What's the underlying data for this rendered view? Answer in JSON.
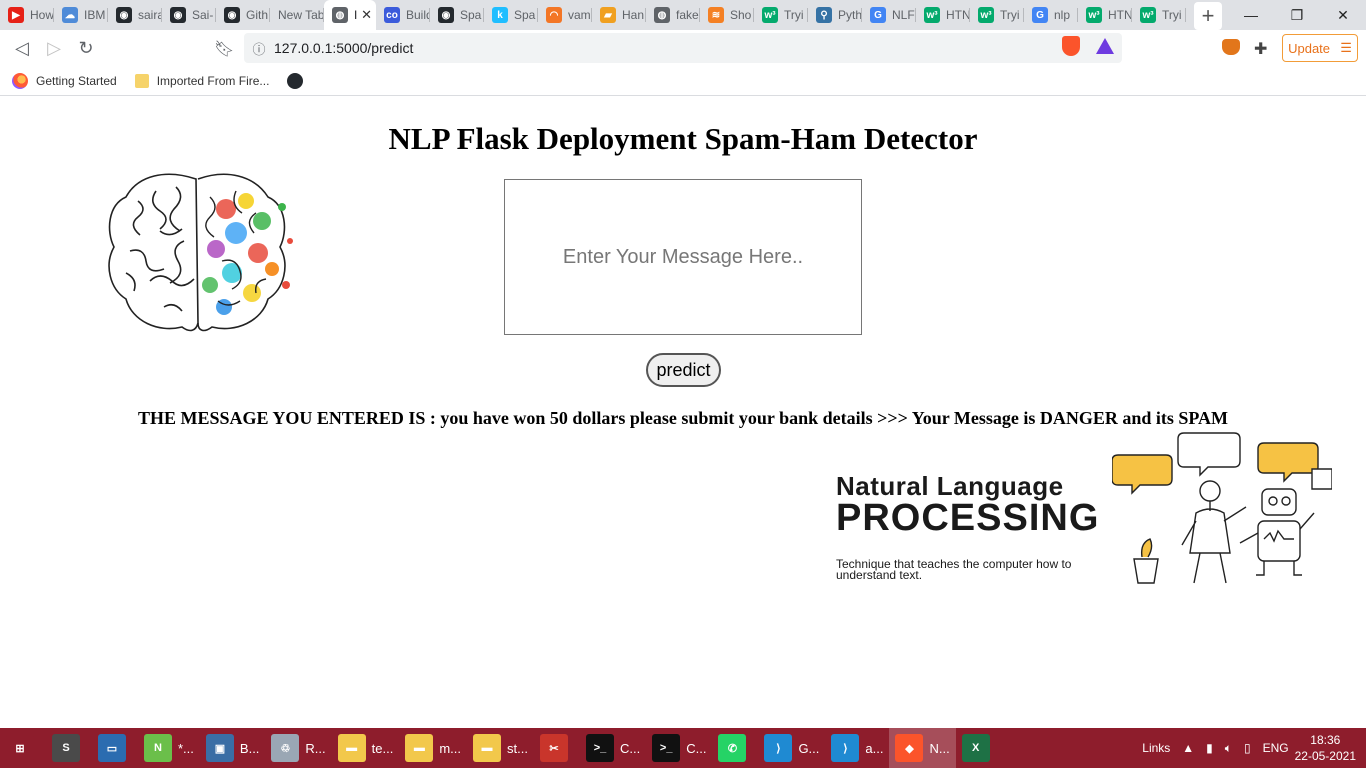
{
  "browser": {
    "tabs": [
      {
        "label": "How",
        "color": "#e62117",
        "glyph": "▶"
      },
      {
        "label": "IBM",
        "color": "#4f8bd8",
        "glyph": "☁"
      },
      {
        "label": "saira",
        "color": "#24292e",
        "glyph": "◉"
      },
      {
        "label": "Sai-",
        "color": "#24292e",
        "glyph": "◉"
      },
      {
        "label": "Gith",
        "color": "#24292e",
        "glyph": "◉"
      },
      {
        "label": "New Tab",
        "color": "",
        "glyph": ""
      },
      {
        "label": "I",
        "color": "#5f6368",
        "glyph": "◍",
        "active": true
      },
      {
        "label": "Build",
        "color": "#3b5bdb",
        "glyph": "co"
      },
      {
        "label": "Spa",
        "color": "#24292e",
        "glyph": "◉"
      },
      {
        "label": "Spa",
        "color": "#20beff",
        "glyph": "k"
      },
      {
        "label": "vam",
        "color": "#f37626",
        "glyph": "◠"
      },
      {
        "label": "Han",
        "color": "#f0a020",
        "glyph": "▰"
      },
      {
        "label": "fake",
        "color": "#5f6368",
        "glyph": "◍"
      },
      {
        "label": "Sho",
        "color": "#f48024",
        "glyph": "≋"
      },
      {
        "label": "Tryi",
        "color": "#04aa6d",
        "glyph": "w³"
      },
      {
        "label": "Pyth",
        "color": "#3572a5",
        "glyph": "⚲"
      },
      {
        "label": "NLF",
        "color": "#4285f4",
        "glyph": "G"
      },
      {
        "label": "HTN",
        "color": "#04aa6d",
        "glyph": "w³"
      },
      {
        "label": "Tryi",
        "color": "#04aa6d",
        "glyph": "w³"
      },
      {
        "label": "nlp",
        "color": "#4285f4",
        "glyph": "G"
      },
      {
        "label": "HTN",
        "color": "#04aa6d",
        "glyph": "w³"
      },
      {
        "label": "Tryi",
        "color": "#04aa6d",
        "glyph": "w³"
      }
    ],
    "url": "127.0.0.1:5000/predict",
    "update_label": "Update",
    "bookmarks": [
      {
        "label": "Getting Started",
        "type": "firefox"
      },
      {
        "label": "Imported From Fire...",
        "type": "folder"
      },
      {
        "label": "",
        "type": "github"
      }
    ]
  },
  "page": {
    "title": "NLP Flask Deployment Spam-Ham Detector",
    "message_placeholder": "Enter Your Message Here..",
    "predict_label": "predict",
    "result_text": "THE MESSAGE YOU ENTERED IS : you have won 50 dollars please submit your bank details >>> Your Message is DANGER and its SPAM",
    "banner": {
      "line1": "Natural Language",
      "line2": "PROCESSING",
      "line3": "Technique that teaches the computer how to understand text."
    }
  },
  "taskbar": {
    "items": [
      {
        "label": "",
        "icon": "windows-start-icon",
        "color": "#8e1d2c",
        "glyph": "⊞"
      },
      {
        "label": "",
        "icon": "sublime-icon",
        "color": "#4a4a4a",
        "glyph": "S"
      },
      {
        "label": "",
        "icon": "remote-desktop-icon",
        "color": "#2b6cb0",
        "glyph": "▭"
      },
      {
        "label": "*...",
        "icon": "notepad-plus-icon",
        "color": "#6bbf4a",
        "glyph": "N"
      },
      {
        "label": "B...",
        "icon": "computer-icon",
        "color": "#3a6ea5",
        "glyph": "▣"
      },
      {
        "label": "R...",
        "icon": "recycle-bin-icon",
        "color": "#9aa7b4",
        "glyph": "♲"
      },
      {
        "label": "te...",
        "icon": "folder-icon",
        "color": "#f2c84b",
        "glyph": "▬"
      },
      {
        "label": "m...",
        "icon": "folder-icon",
        "color": "#f2c84b",
        "glyph": "▬"
      },
      {
        "label": "st...",
        "icon": "folder-icon",
        "color": "#f2c84b",
        "glyph": "▬"
      },
      {
        "label": "",
        "icon": "snipping-tool-icon",
        "color": "#c9352b",
        "glyph": "✂"
      },
      {
        "label": "C...",
        "icon": "cmd-icon",
        "color": "#111111",
        "glyph": ">_"
      },
      {
        "label": "C...",
        "icon": "cmd-icon",
        "color": "#111111",
        "glyph": ">_"
      },
      {
        "label": "",
        "icon": "whatsapp-icon",
        "color": "#25d366",
        "glyph": "✆"
      },
      {
        "label": "G...",
        "icon": "vscode-icon",
        "color": "#1f8ad2",
        "glyph": "⟩"
      },
      {
        "label": "a...",
        "icon": "vscode-icon",
        "color": "#1f8ad2",
        "glyph": "⟩"
      },
      {
        "label": "N...",
        "icon": "brave-icon",
        "color": "#fb542b",
        "glyph": "◆",
        "active": true
      },
      {
        "label": "",
        "icon": "excel-icon",
        "color": "#1e7145",
        "glyph": "X"
      }
    ],
    "tray": {
      "links_label": "Links",
      "lang": "ENG",
      "time": "18:36",
      "date": "22-05-2021"
    }
  }
}
